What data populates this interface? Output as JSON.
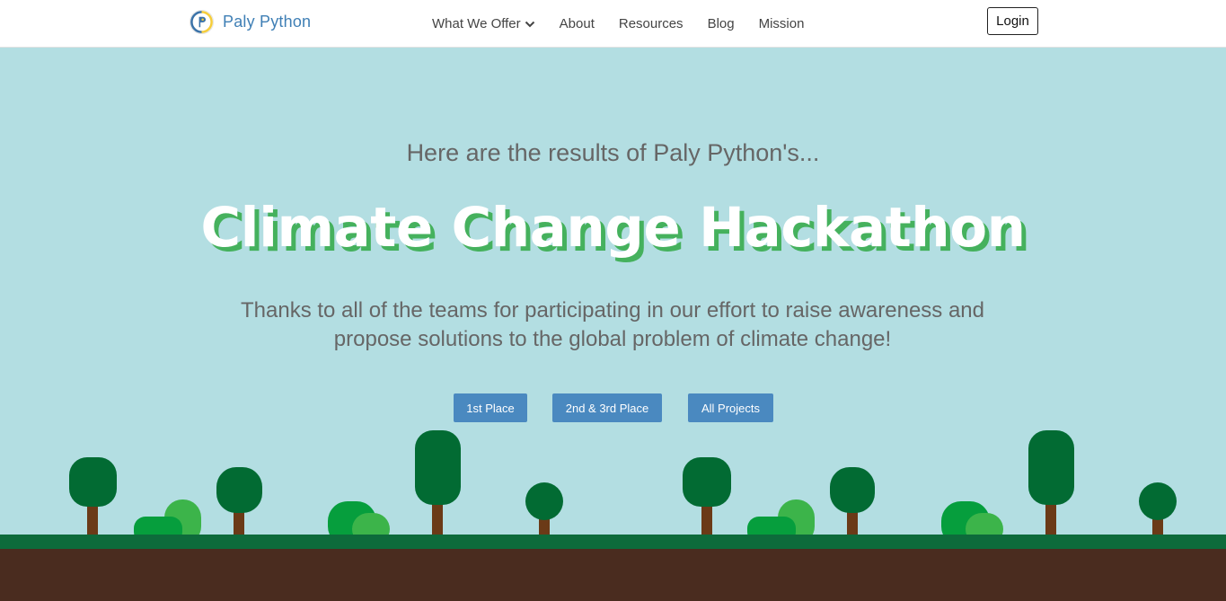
{
  "nav": {
    "brand": "Paly Python",
    "links": [
      {
        "label": "What We Offer"
      },
      {
        "label": "About"
      },
      {
        "label": "Resources"
      },
      {
        "label": "Blog"
      },
      {
        "label": "Mission"
      }
    ],
    "login": "Login"
  },
  "hero": {
    "subtitle": "Here are the results of Paly Python's...",
    "title": "Climate Change Hackathon",
    "description": "Thanks to all of the teams for participating in our effort to raise awareness and propose solutions to the global problem of climate change!",
    "buttons": [
      {
        "label": "1st Place"
      },
      {
        "label": "2nd & 3rd Place"
      },
      {
        "label": "All Projects"
      }
    ]
  },
  "colors": {
    "brand": "#3f7fb5",
    "button": "#4a89c0",
    "sky": "#b3dee2",
    "title_shadow": "#45b15d",
    "tree_dark": "#026b33",
    "bush_light": "#3cb44a",
    "grass": "#0d6b3b",
    "dirt": "#4a2c1f",
    "trunk": "#6b3a17"
  },
  "icons": {
    "brand_logo": "python-logo-icon",
    "dropdown": "chevron-down-icon"
  }
}
